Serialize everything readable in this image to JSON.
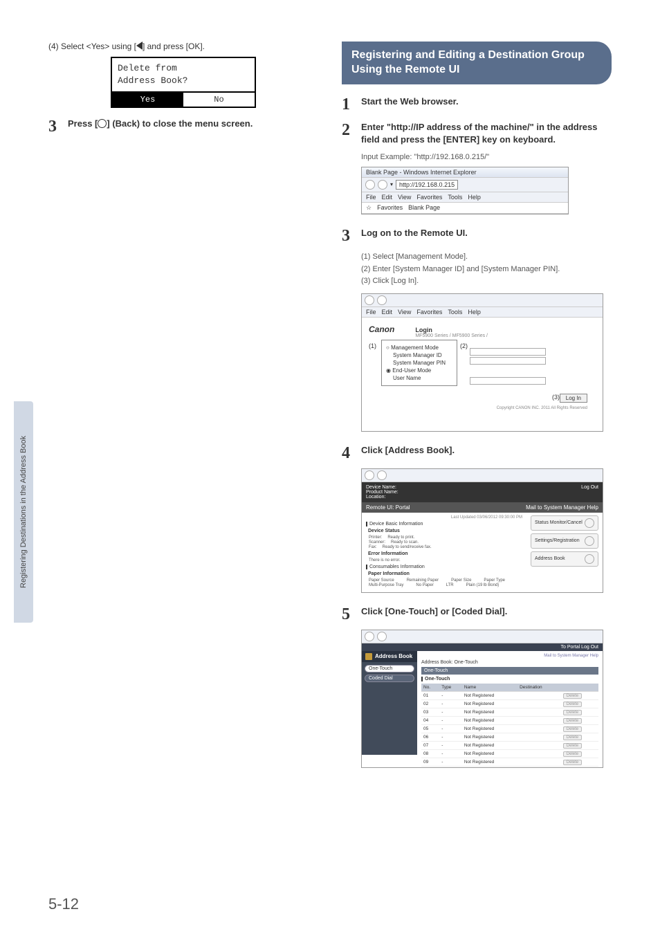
{
  "side_tab": "Registering Destinations in the Address Book",
  "page_num": "5-12",
  "left": {
    "step4_text": "(4) Select <Yes> using [",
    "step4_text2": "] and press [OK].",
    "lcd_line1": "Delete from",
    "lcd_line2": "Address Book?",
    "lcd_yes": "Yes",
    "lcd_no": "No",
    "step3_num": "3",
    "step3_text_a": "Press [",
    "step3_text_b": "] (Back) to close the menu screen."
  },
  "right": {
    "section_title": "Registering and Editing a Destination Group Using the Remote UI",
    "s1_num": "1",
    "s1_text": "Start the Web browser.",
    "s2_num": "2",
    "s2_text": "Enter \"http://IP address of the machine/\" in the address field and press  the [ENTER] key on keyboard.",
    "input_example": "Input Example: \"http://192.168.0.215/\"",
    "ie_title": "Blank Page - Windows Internet Explorer",
    "ie_url": "http://192.168.0.215",
    "ie_menu": [
      "File",
      "Edit",
      "View",
      "Favorites",
      "Tools",
      "Help"
    ],
    "ie_fav": "Favorites",
    "ie_blank": "Blank Page",
    "s3_num": "3",
    "s3_text": "Log on to the Remote UI.",
    "s3_sub": [
      "(1)  Select [Management Mode].",
      "(2)  Enter [System Manager ID] and [System Manager PIN].",
      "(3)  Click [Log In]."
    ],
    "login": {
      "canon": "Canon",
      "login": "Login",
      "sub": "MF5900 Series / MF5900 Series /",
      "mgmt": "Management Mode",
      "smid": "System Manager ID",
      "smpin": "System Manager PIN",
      "enduser": "End-User Mode",
      "username": "User Name",
      "login_btn": "Log In",
      "copyright": "Copyright CANON INC. 2011 All Rights Reserved",
      "c1": "(1)",
      "c2": "(2)",
      "c3": "(3)"
    },
    "s4_num": "4",
    "s4_text": "Click [Address Book].",
    "portal": {
      "dev_name": "Device Name:",
      "prod_name": "Product Name:",
      "location": "Location:",
      "logout": "Log Out",
      "title": "Remote UI: Portal",
      "mail": "Mail to System Manager  Help",
      "updated": "Last Updated 03/06/2012 09:30:00 PM",
      "dbi": "Device Basic Information",
      "ds": "Device Status",
      "printer": "Printer:",
      "printer_s": "Ready to print.",
      "scanner": "Scanner:",
      "scanner_s": "Ready to scan.",
      "fax": "Fax:",
      "fax_s": "Ready to send/receive fax.",
      "err": "Error Information",
      "noerr": "There is no error.",
      "cons": "Consumables Information",
      "pinfo": "Paper Information",
      "psrc": "Paper Source",
      "prem": "Remaining Paper",
      "psize": "Paper Size",
      "ptype": "Paper Type",
      "mpt": "Multi-Purpose Tray",
      "nopaper": "No Paper",
      "ltr": "LTR",
      "plain": "Plain (19 lb Bond)",
      "smc": "Status Monitor/Cancel",
      "sreg": "Settings/Registration",
      "abook": "Address Book"
    },
    "s5_num": "5",
    "s5_text": "Click [One-Touch] or [Coded Dial].",
    "ot": {
      "topbar_right": "To Portal  Log Out",
      "title": "Address Book",
      "mail": "Mail to System Manager  Help",
      "tab1": "One-Touch",
      "tab2": "Coded Dial",
      "crumb": "Address Book: One-Touch",
      "heading": "One-Touch",
      "cols": [
        "No.",
        "Type",
        "Name",
        "Destination",
        ""
      ],
      "rows": [
        {
          "no": "01",
          "type": "-",
          "name": "Not Registered"
        },
        {
          "no": "02",
          "type": "-",
          "name": "Not Registered"
        },
        {
          "no": "03",
          "type": "-",
          "name": "Not Registered"
        },
        {
          "no": "04",
          "type": "-",
          "name": "Not Registered"
        },
        {
          "no": "05",
          "type": "-",
          "name": "Not Registered"
        },
        {
          "no": "06",
          "type": "-",
          "name": "Not Registered"
        },
        {
          "no": "07",
          "type": "-",
          "name": "Not Registered"
        },
        {
          "no": "08",
          "type": "-",
          "name": "Not Registered"
        },
        {
          "no": "09",
          "type": "-",
          "name": "Not Registered"
        }
      ],
      "delete": "Delete"
    }
  }
}
